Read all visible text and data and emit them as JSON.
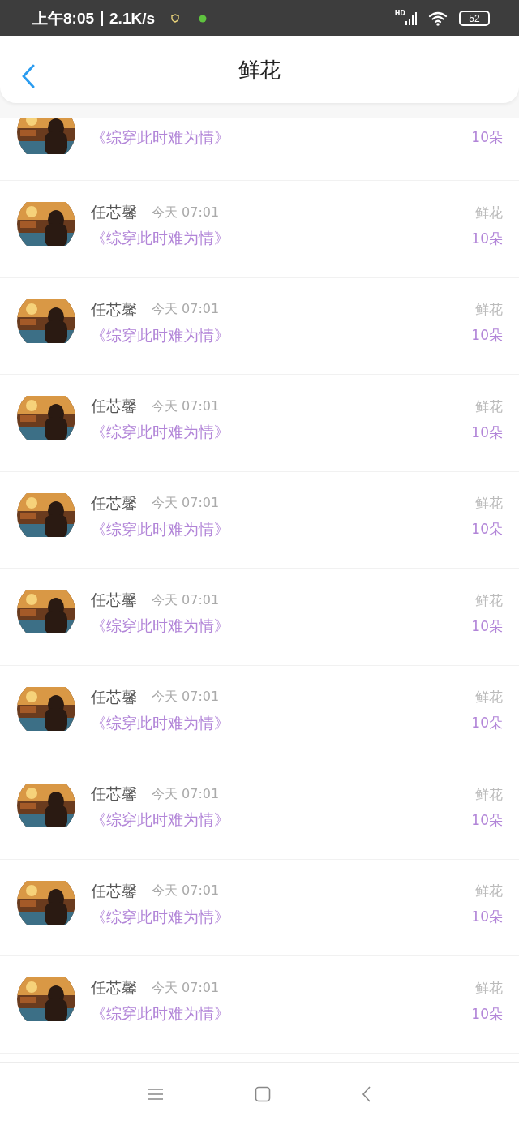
{
  "status_bar": {
    "time": "上午8:05",
    "speed": "2.1K/s",
    "signal_label": "HD",
    "battery": "52"
  },
  "header": {
    "title": "鲜花"
  },
  "partial_row": {
    "book": "《综穿此时难为情》",
    "amount": "10朵"
  },
  "rows": [
    {
      "name": "任芯馨",
      "time": "今天 07:01",
      "book": "《综穿此时难为情》",
      "gift": "鲜花",
      "amount": "10朵"
    },
    {
      "name": "任芯馨",
      "time": "今天 07:01",
      "book": "《综穿此时难为情》",
      "gift": "鲜花",
      "amount": "10朵"
    },
    {
      "name": "任芯馨",
      "time": "今天 07:01",
      "book": "《综穿此时难为情》",
      "gift": "鲜花",
      "amount": "10朵"
    },
    {
      "name": "任芯馨",
      "time": "今天 07:01",
      "book": "《综穿此时难为情》",
      "gift": "鲜花",
      "amount": "10朵"
    },
    {
      "name": "任芯馨",
      "time": "今天 07:01",
      "book": "《综穿此时难为情》",
      "gift": "鲜花",
      "amount": "10朵"
    },
    {
      "name": "任芯馨",
      "time": "今天 07:01",
      "book": "《综穿此时难为情》",
      "gift": "鲜花",
      "amount": "10朵"
    },
    {
      "name": "任芯馨",
      "time": "今天 07:01",
      "book": "《综穿此时难为情》",
      "gift": "鲜花",
      "amount": "10朵"
    },
    {
      "name": "任芯馨",
      "time": "今天 07:01",
      "book": "《综穿此时难为情》",
      "gift": "鲜花",
      "amount": "10朵"
    },
    {
      "name": "任芯馨",
      "time": "今天 07:01",
      "book": "《综穿此时难为情》",
      "gift": "鲜花",
      "amount": "10朵"
    }
  ]
}
